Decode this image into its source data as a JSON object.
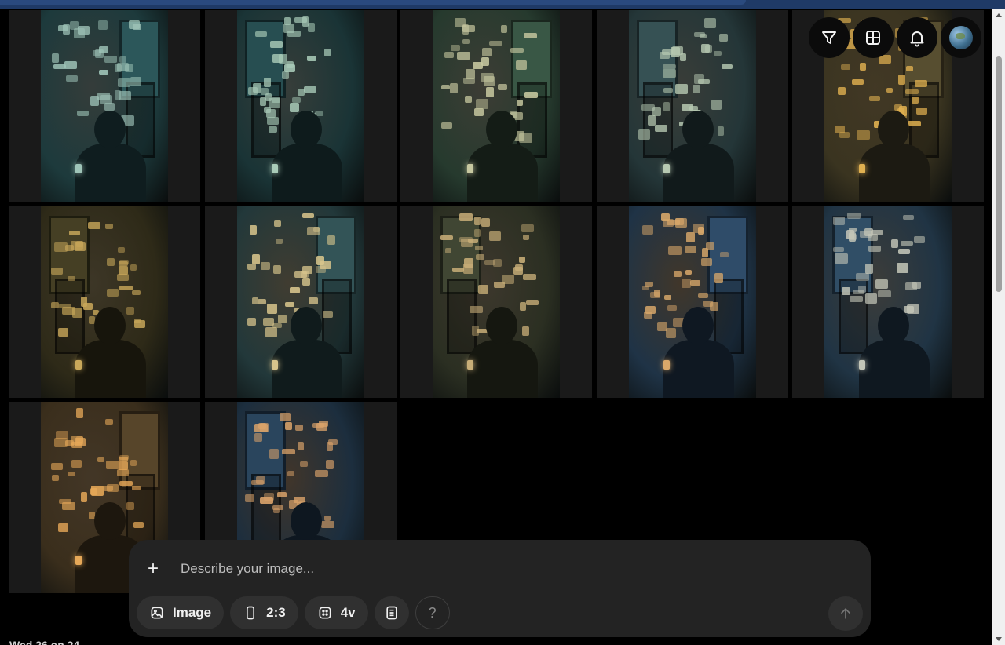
{
  "gallery": {
    "tiles": [
      {
        "tone": "teal",
        "bg": "#1d3a3c",
        "glow": "#9fc4b8",
        "figure": "#0f1d1f"
      },
      {
        "tone": "teal",
        "bg": "#1a3436",
        "glow": "#a9cbb8",
        "figure": "#0e1b1c"
      },
      {
        "tone": "green",
        "bg": "#263a2e",
        "glow": "#c7c8a0",
        "figure": "#141c16"
      },
      {
        "tone": "slate",
        "bg": "#243638",
        "glow": "#b7c9b2",
        "figure": "#111a1b"
      },
      {
        "tone": "amber",
        "bg": "#3a3420",
        "glow": "#e0b050",
        "figure": "#1c1a12"
      },
      {
        "tone": "olive",
        "bg": "#2e2a18",
        "glow": "#c9a85a",
        "figure": "#17150c"
      },
      {
        "tone": "teal",
        "bg": "#22383a",
        "glow": "#d8c58c",
        "figure": "#101b1c"
      },
      {
        "tone": "olive",
        "bg": "#2b2f22",
        "glow": "#c8ae78",
        "figure": "#151710"
      },
      {
        "tone": "blue",
        "bg": "#1f3346",
        "glow": "#d9a86a",
        "figure": "#0f1822"
      },
      {
        "tone": "blue",
        "bg": "#203444",
        "glow": "#c4c6b8",
        "figure": "#0f1820"
      },
      {
        "tone": "amber",
        "bg": "#3a2e1c",
        "glow": "#e6a858",
        "figure": "#1d170e"
      },
      {
        "tone": "navy",
        "bg": "#1c2e3e",
        "glow": "#dba36a",
        "figure": "#0e1720"
      }
    ]
  },
  "top_actions": {
    "filter_icon": "filter-icon",
    "grid_icon": "grid-icon",
    "bell_icon": "bell-icon",
    "avatar_icon": "globe-avatar-icon"
  },
  "prompt": {
    "plus_label": "+",
    "placeholder": "Describe your image..."
  },
  "controls": {
    "image_label": "Image",
    "ratio_label": "2:3",
    "variations_label": "4v",
    "help_label": "?"
  },
  "footer": {
    "partial_text": "Wed 26 on 24"
  }
}
